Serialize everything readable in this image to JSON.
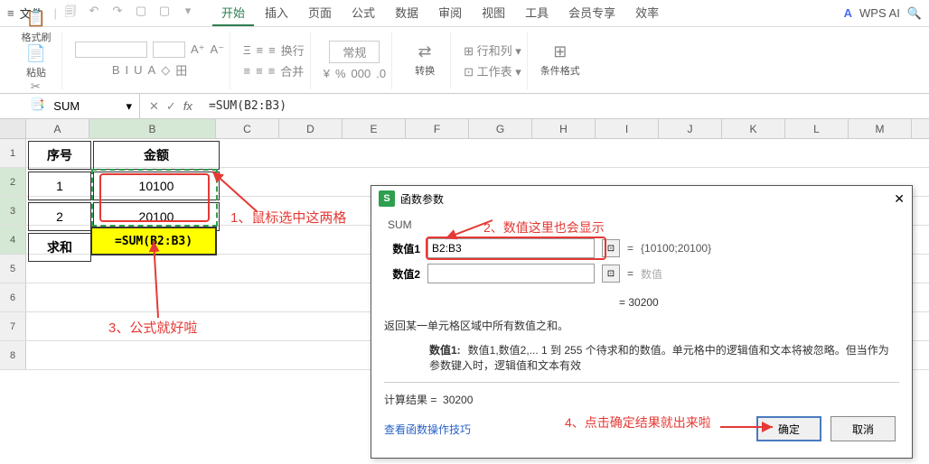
{
  "menu": {
    "file": "文件",
    "tabs": [
      "开始",
      "插入",
      "页面",
      "公式",
      "数据",
      "审阅",
      "视图",
      "工具",
      "会员专享",
      "效率"
    ],
    "active_tab": 0,
    "ai_label": "WPS AI"
  },
  "ribbon": {
    "format_brush": "格式刷",
    "paste": "粘贴",
    "number_format": "常规",
    "convert": "转换",
    "rowcol": "行和列",
    "worksheet": "工作表",
    "cond_format": "条件格式",
    "font_row1": [
      "A⁺",
      "A⁻",
      "Ξ",
      "≡",
      "≡",
      "≡",
      "换行"
    ],
    "font_row2": [
      "B",
      "I",
      "U",
      "A",
      "◇",
      "田",
      "≡",
      "≡",
      "≡",
      "合并"
    ]
  },
  "formula_bar": {
    "name": "SUM",
    "formula": "=SUM(B2:B3)"
  },
  "columns": [
    "A",
    "B",
    "C",
    "D",
    "E",
    "F",
    "G",
    "H",
    "I",
    "J",
    "K",
    "L",
    "M"
  ],
  "rows_visible": [
    1,
    2,
    3,
    4,
    5,
    6,
    7,
    8
  ],
  "table": {
    "hdr_a": "序号",
    "hdr_b": "金额",
    "r1_a": "1",
    "r1_b": "10100",
    "r2_a": "2",
    "r2_b": "20100",
    "r3_a": "求和",
    "r3_b": "=SUM(B2:B3)"
  },
  "annotations": {
    "a1": "1、鼠标选中这两格",
    "a2": "2、数值这里也会显示",
    "a3": "3、公式就好啦",
    "a4": "4、点击确定结果就出来啦"
  },
  "dialog": {
    "title": "函数参数",
    "func": "SUM",
    "param1_label": "数值1",
    "param1_value": "B2:B3",
    "param1_preview": "{10100;20100}",
    "param2_label": "数值2",
    "param2_value": "",
    "param2_preview": "数值",
    "result_eq": "= 30200",
    "desc": "返回某一单元格区域中所有数值之和。",
    "desc_param_label": "数值1:",
    "desc_param_text": "数值1,数值2,... 1 到 255 个待求和的数值。单元格中的逻辑值和文本将被忽略。但当作为参数键入时，逻辑值和文本有效",
    "calc_result_label": "计算结果 =",
    "calc_result_value": "30200",
    "help_link": "查看函数操作技巧",
    "ok": "确定",
    "cancel": "取消"
  },
  "chart_data": {
    "type": "table",
    "columns": [
      "序号",
      "金额"
    ],
    "rows": [
      [
        "1",
        10100
      ],
      [
        "2",
        20100
      ]
    ],
    "sum": 30200
  }
}
